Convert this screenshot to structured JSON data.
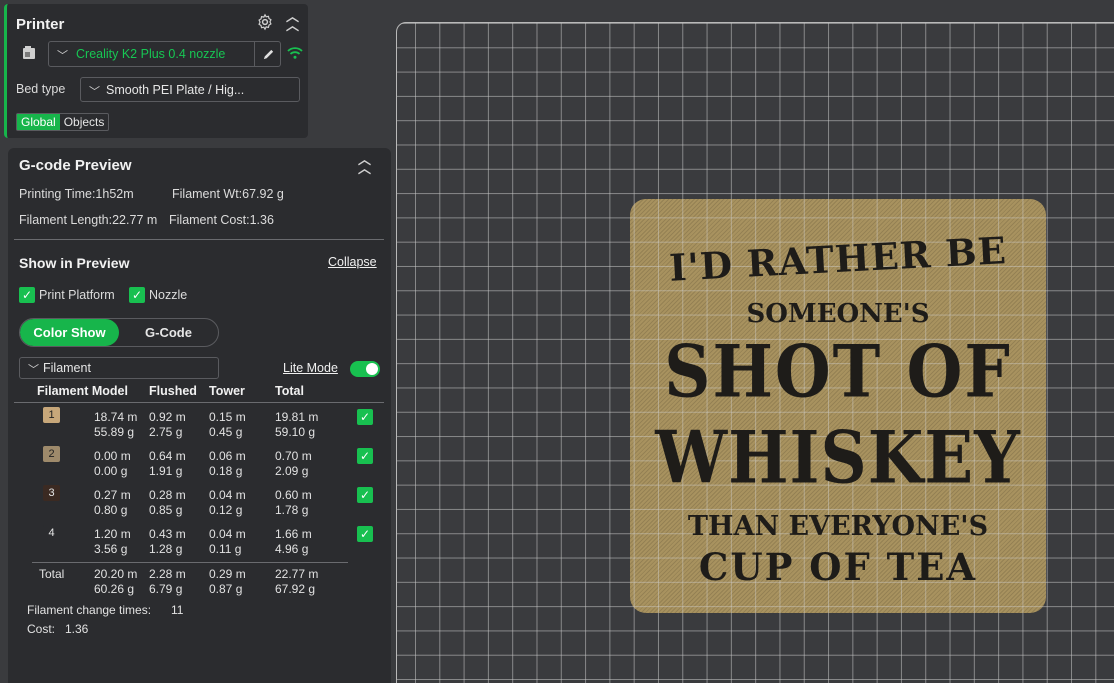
{
  "printer": {
    "title": "Printer",
    "printer_name": "Creality K2 Plus 0.4 nozzle",
    "bed_type_label": "Bed type",
    "bed_type_value": "Smooth PEI Plate / Hig...",
    "scope_global": "Global",
    "scope_objects": "Objects"
  },
  "gcode_preview": {
    "title": "G-code Preview",
    "printing_time": "Printing Time:1h52m",
    "filament_wt": "Filament Wt:67.92 g",
    "filament_length": "Filament Length:22.77 m",
    "filament_cost": "Filament Cost:1.36"
  },
  "show_in_preview": {
    "title": "Show in Preview",
    "collapse_label": "Collapse",
    "print_platform_label": "Print Platform",
    "nozzle_label": "Nozzle",
    "color_show_label": "Color Show",
    "gcode_label": "G-Code",
    "view_dropdown_value": "Filament",
    "lite_mode_label": "Lite Mode"
  },
  "filament_table": {
    "headers": [
      "Filament Model",
      "Flushed",
      "Tower",
      "Total"
    ],
    "rows": [
      {
        "id": "1",
        "color": "#c7a77a",
        "model": "18.74 m\n55.89 g",
        "flushed": "0.92 m\n2.75 g",
        "tower": "0.15 m\n0.45 g",
        "total": "19.81 m\n59.10 g"
      },
      {
        "id": "2",
        "color": "#9e8a6b",
        "model": "0.00 m\n0.00 g",
        "flushed": "0.64 m\n1.91 g",
        "tower": "0.06 m\n0.18 g",
        "total": "0.70 m\n2.09 g"
      },
      {
        "id": "3",
        "color": "#3b2a22",
        "model": "0.27 m\n0.80 g",
        "flushed": "0.28 m\n0.85 g",
        "tower": "0.04 m\n0.12 g",
        "total": "0.60 m\n1.78 g"
      },
      {
        "id": "4",
        "color": "#2b2c2f",
        "model": "1.20 m\n3.56 g",
        "flushed": "0.43 m\n1.28 g",
        "tower": "0.04 m\n0.11 g",
        "total": "1.66 m\n4.96 g"
      }
    ],
    "total_label": "Total",
    "total_model": "20.20 m\n60.26 g",
    "total_flushed": "2.28 m\n6.79 g",
    "total_tower": "0.29 m\n0.87 g",
    "total_total": "22.77 m\n67.92 g",
    "change_times_label": "Filament change times:",
    "change_times_value": "11",
    "cost_label": "Cost:",
    "cost_value": "1.36"
  },
  "model_text": {
    "line1": "I'D RATHER BE",
    "line2": "SOMEONE'S",
    "line3": "SHOT OF",
    "line4": "WHISKEY",
    "line5": "THAN EVERYONE'S",
    "line6": "CUP OF TEA"
  },
  "colors": {
    "accent": "#17b54b",
    "panel_bg": "#2b2c2f",
    "canvas_bg": "#3a3b3e",
    "model_color": "#a8925f"
  },
  "icons": [
    "printer-icon",
    "gear-icon",
    "collapse-up-icon",
    "edit-icon",
    "wifi-icon",
    "chevron-down-icon",
    "check-icon"
  ]
}
